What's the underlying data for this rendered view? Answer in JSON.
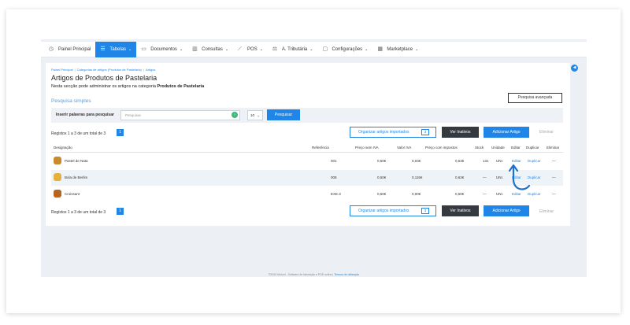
{
  "nav": [
    {
      "label": "Painel Principal",
      "icon": "dashboard-icon",
      "glyph": "◷",
      "chev": ""
    },
    {
      "label": "Tabelas",
      "icon": "tables-icon",
      "glyph": "☰",
      "chev": "⌄",
      "active": true
    },
    {
      "label": "Documentos",
      "icon": "document-icon",
      "glyph": "▭",
      "chev": "⌄"
    },
    {
      "label": "Consultas",
      "icon": "bar-chart-icon",
      "glyph": "▥",
      "chev": "⌄"
    },
    {
      "label": "POS",
      "icon": "pos-icon",
      "glyph": "⟋",
      "chev": "⌄"
    },
    {
      "label": "A. Tributária",
      "icon": "scale-icon",
      "glyph": "⚖",
      "chev": "⌄"
    },
    {
      "label": "Configurações",
      "icon": "settings-icon",
      "glyph": "▢",
      "chev": "⌄"
    },
    {
      "label": "Marketplace",
      "icon": "grid-icon",
      "glyph": "▦",
      "chev": "⌄"
    }
  ],
  "breadcrumb": [
    "Painel Principal",
    "Categorias de artigos (Produtos de Pastelaria)",
    "Artigos"
  ],
  "page": {
    "title": "Artigos de Produtos de Pastelaria",
    "subtitle_prefix": "Nesta secção pode administrar os artigos na categoria ",
    "subtitle_bold": "Produtos de Pastelaria",
    "advanced_search": "Pesquisa avançada",
    "simple_search": "Pesquisa simples"
  },
  "search": {
    "label": "Inserir palavras para pesquisar",
    "placeholder": "Pesquisar",
    "per_page": "10",
    "button": "Pesquisar"
  },
  "toolbar": {
    "records": "Registos 1 a 3 de um total de 3",
    "page": "1",
    "organize": "Organizar artigos importados",
    "organize_count": "3",
    "inactive": "Ver Inativos",
    "add": "Adicionar Artigo",
    "delete": "Eliminar"
  },
  "table": {
    "headers": [
      "Designação",
      "Referência",
      "Preço sem IVA",
      "Valor IVA",
      "Preço com impostos",
      "Stock",
      "Unidade",
      "Editar",
      "Duplicar",
      "Eliminar"
    ],
    "rows": [
      {
        "name": "Pastel de Nata",
        "ref": "001",
        "price": "0,50€",
        "vat": "0,03€",
        "total": "0,53€",
        "stock": "131",
        "unit": "UNI.",
        "edit": "Editar",
        "dup": "Duplicar",
        "del": "—",
        "thumb_color": "#c98a2e"
      },
      {
        "name": "Bola de Berlim",
        "ref": "008",
        "price": "0,50€",
        "vat": "0,115€",
        "total": "0,62€",
        "stock": "—",
        "unit": "UNI.",
        "edit": "Editar",
        "dup": "Duplicar",
        "del": "—",
        "thumb_color": "#e3b13c"
      },
      {
        "name": "Croissant",
        "ref": "EXE.3",
        "price": "0,50€",
        "vat": "0,00€",
        "total": "0,50€",
        "stock": "—",
        "unit": "UNI.",
        "edit": "Editar",
        "dup": "Duplicar",
        "del": "—",
        "thumb_color": "#b5651d"
      }
    ]
  },
  "footer": {
    "text": "©2024 Moloni - Software de faturação e POS online | ",
    "link": "Termos de utilização"
  }
}
